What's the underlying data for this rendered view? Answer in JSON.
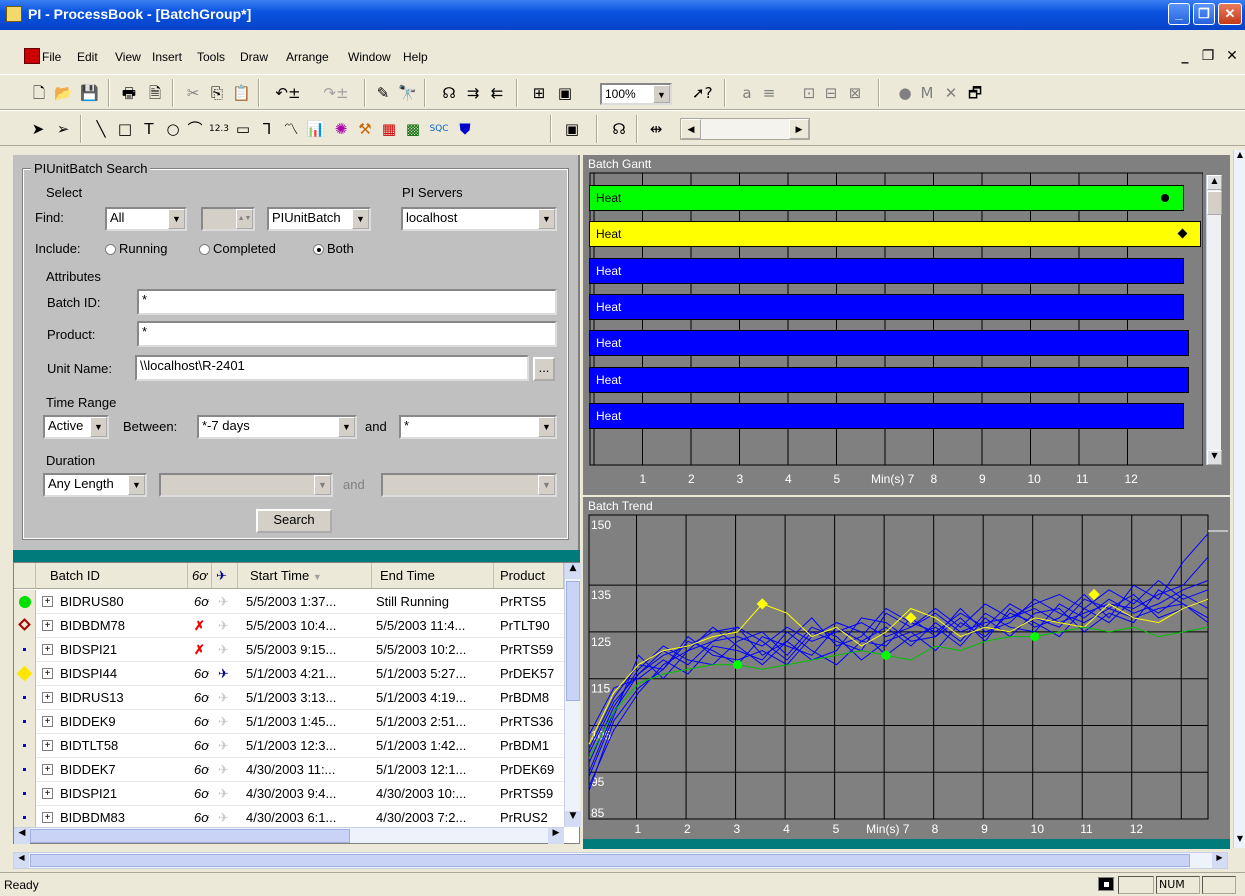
{
  "window": {
    "title": "PI - ProcessBook - [BatchGroup*]"
  },
  "menu": [
    "File",
    "Edit",
    "View",
    "Insert",
    "Tools",
    "Draw",
    "Arrange",
    "Window",
    "Help"
  ],
  "toolbar": {
    "zoom": "100%"
  },
  "search": {
    "title": "PIUnitBatch Search",
    "select_label": "Select",
    "find_label": "Find:",
    "find_value": "All",
    "type_value": "PIUnitBatch",
    "servers_label": "PI Servers",
    "server_value": "localhost",
    "include_label": "Include:",
    "include_options": [
      "Running",
      "Completed",
      "Both"
    ],
    "include_selected": "Both",
    "attributes_label": "Attributes",
    "batch_id_label": "Batch ID:",
    "batch_id_value": "*",
    "product_label": "Product:",
    "product_value": "*",
    "unit_label": "Unit Name:",
    "unit_value": "\\\\localhost\\R-2401",
    "browse_label": "...",
    "time_range_label": "Time Range",
    "time_mode": "Active",
    "between_label": "Between:",
    "start_value": "*-7 days",
    "and_label": "and",
    "end_value": "*",
    "duration_label": "Duration",
    "duration_value": "Any Length",
    "duration_and": "and",
    "search_button": "Search"
  },
  "grid": {
    "headers": [
      "Batch ID",
      "Start Time",
      "End Time",
      "Product"
    ],
    "rows": [
      {
        "status": "green",
        "id": "BIDRUS80",
        "start": "5/5/2003 1:37...",
        "end": "Still Running",
        "product": "PrRTS5",
        "open": true,
        "trend": false
      },
      {
        "status": "red-diamond",
        "id": "BIDBDM78",
        "start": "5/5/2003 10:4...",
        "end": "5/5/2003 11:4...",
        "product": "PrTLT90",
        "open": false,
        "trend": false
      },
      {
        "status": "dot",
        "id": "BIDSPI21",
        "start": "5/5/2003 9:15...",
        "end": "5/5/2003 10:2...",
        "product": "PrRTS59",
        "open": false,
        "trend": false
      },
      {
        "status": "yellow",
        "id": "BIDSPI44",
        "start": "5/1/2003 4:21...",
        "end": "5/1/2003 5:27...",
        "product": "PrDEK57",
        "open": true,
        "trend": true
      },
      {
        "status": "dot",
        "id": "BIDRUS13",
        "start": "5/1/2003 3:13...",
        "end": "5/1/2003 4:19...",
        "product": "PrBDM8",
        "open": true,
        "trend": false
      },
      {
        "status": "dot",
        "id": "BIDDEK9",
        "start": "5/1/2003 1:45...",
        "end": "5/1/2003 2:51...",
        "product": "PrRTS36",
        "open": true,
        "trend": false
      },
      {
        "status": "dot",
        "id": "BIDTLT58",
        "start": "5/1/2003 12:3...",
        "end": "5/1/2003 1:42...",
        "product": "PrBDM1",
        "open": true,
        "trend": false
      },
      {
        "status": "dot",
        "id": "BIDDEK7",
        "start": "4/30/2003 11:...",
        "end": "5/1/2003 12:1...",
        "product": "PrDEK69",
        "open": true,
        "trend": false
      },
      {
        "status": "dot",
        "id": "BIDSPI21",
        "start": "4/30/2003 9:4...",
        "end": "4/30/2003 10:...",
        "product": "PrRTS59",
        "open": true,
        "trend": false
      },
      {
        "status": "dot",
        "id": "BIDBDM83",
        "start": "4/30/2003 6:1...",
        "end": "4/30/2003 7:2...",
        "product": "PrRUS2",
        "open": true,
        "trend": false
      }
    ]
  },
  "gantt": {
    "title": "Batch Gantt",
    "bars": [
      {
        "label": "Heat",
        "color": "#00ff00",
        "marker": "circle"
      },
      {
        "label": "Heat",
        "color": "#ffff00",
        "marker": "diamond"
      },
      {
        "label": "Heat",
        "color": "#0000ff",
        "marker": ""
      },
      {
        "label": "Heat",
        "color": "#0000ff",
        "marker": ""
      },
      {
        "label": "Heat",
        "color": "#0000ff",
        "marker": ""
      },
      {
        "label": "Heat",
        "color": "#0000ff",
        "marker": ""
      },
      {
        "label": "Heat",
        "color": "#0000ff",
        "marker": ""
      }
    ],
    "x_ticks": [
      "1",
      "2",
      "3",
      "4",
      "5",
      "Min(s) 7",
      "8",
      "9",
      "10",
      "11",
      "12"
    ]
  },
  "trend": {
    "title": "Batch Trend",
    "y_ticks": [
      "150",
      "135",
      "125",
      "115",
      "105",
      "95",
      "85"
    ],
    "x_ticks": [
      "1",
      "2",
      "3",
      "4",
      "5",
      "Min(s) 7",
      "8",
      "9",
      "10",
      "11",
      "12"
    ]
  },
  "chart_data": {
    "type": "line",
    "title": "Batch Trend",
    "xlabel": "Min(s)",
    "ylabel": "",
    "xlim": [
      0,
      12.5
    ],
    "ylim": [
      85,
      150
    ],
    "x": [
      0,
      0.5,
      1,
      1.5,
      2,
      2.5,
      3,
      3.5,
      4,
      4.5,
      5,
      5.5,
      6,
      6.5,
      7,
      7.5,
      8,
      8.5,
      9,
      9.5,
      10,
      10.5,
      11,
      11.5,
      12,
      12.5
    ],
    "series": [
      {
        "name": "",
        "color": "#ffff00",
        "values": [
          101,
          112,
          118,
          121,
          122,
          124,
          125,
          131,
          129,
          124,
          126,
          122,
          125,
          130,
          128,
          124,
          126,
          125,
          128,
          127,
          126,
          131,
          128,
          127,
          130,
          132
        ]
      },
      {
        "name": "",
        "color": "#00c000",
        "values": [
          98,
          108,
          114,
          116,
          117,
          118,
          118,
          117,
          118,
          119,
          120,
          121,
          120,
          119,
          122,
          121,
          123,
          124,
          124,
          125,
          126,
          125,
          126,
          124,
          125,
          126
        ]
      },
      {
        "name": "",
        "color": "#0000ff",
        "values": [
          92,
          104,
          112,
          118,
          121,
          123,
          124,
          122,
          126,
          123,
          125,
          127,
          124,
          126,
          129,
          125,
          127,
          128,
          130,
          127,
          129,
          131,
          130,
          133,
          135,
          141
        ]
      },
      {
        "name": "",
        "color": "#0000ff",
        "values": [
          95,
          108,
          116,
          120,
          122,
          125,
          126,
          120,
          123,
          128,
          122,
          124,
          130,
          127,
          125,
          129,
          126,
          131,
          128,
          126,
          132,
          130,
          128,
          130,
          131,
          127
        ]
      },
      {
        "name": "",
        "color": "#0000ff",
        "values": [
          100,
          111,
          118,
          117,
          123,
          121,
          118,
          124,
          122,
          120,
          126,
          123,
          122,
          128,
          124,
          130,
          125,
          127,
          132,
          129,
          127,
          130,
          133,
          128,
          130,
          132
        ]
      },
      {
        "name": "",
        "color": "#0000ff",
        "values": [
          103,
          113,
          115,
          119,
          116,
          122,
          121,
          119,
          125,
          121,
          118,
          123,
          126,
          122,
          127,
          123,
          129,
          126,
          125,
          131,
          128,
          132,
          129,
          131,
          134,
          136
        ]
      },
      {
        "name": "",
        "color": "#0000ff",
        "values": [
          97,
          109,
          117,
          122,
          119,
          118,
          123,
          125,
          120,
          126,
          124,
          119,
          123,
          125,
          121,
          127,
          124,
          129,
          127,
          124,
          130,
          127,
          132,
          129,
          133,
          130
        ]
      },
      {
        "name": "",
        "color": "#0000ff",
        "values": [
          91,
          106,
          113,
          117,
          124,
          120,
          119,
          121,
          118,
          124,
          127,
          125,
          120,
          124,
          126,
          122,
          128,
          124,
          129,
          130,
          125,
          129,
          127,
          134,
          131,
          128
        ]
      },
      {
        "name": "",
        "color": "#0000ff",
        "values": [
          94,
          107,
          120,
          115,
          121,
          126,
          122,
          118,
          123,
          119,
          121,
          128,
          127,
          123,
          124,
          128,
          123,
          130,
          126,
          128,
          133,
          128,
          135,
          132,
          140,
          146
        ]
      },
      {
        "name": "",
        "color": "#0000ff",
        "values": [
          99,
          110,
          116,
          121,
          118,
          123,
          126,
          123,
          119,
          125,
          123,
          121,
          129,
          126,
          130,
          126,
          131,
          128,
          131,
          133,
          130,
          134,
          131,
          136,
          132,
          134
        ]
      }
    ],
    "markers": [
      {
        "series": 0,
        "x": 3.5,
        "y": 131,
        "color": "#ffff00"
      },
      {
        "series": 0,
        "x": 6.5,
        "y": 128,
        "color": "#ffff00"
      },
      {
        "series": 0,
        "x": 10.2,
        "y": 133,
        "color": "#ffff00"
      },
      {
        "series": 1,
        "x": 3,
        "y": 118,
        "color": "#00ff00"
      },
      {
        "series": 1,
        "x": 6,
        "y": 120,
        "color": "#00ff00"
      },
      {
        "series": 1,
        "x": 9,
        "y": 124,
        "color": "#00ff00"
      }
    ]
  },
  "status": {
    "text": "Ready",
    "num": "NUM"
  }
}
